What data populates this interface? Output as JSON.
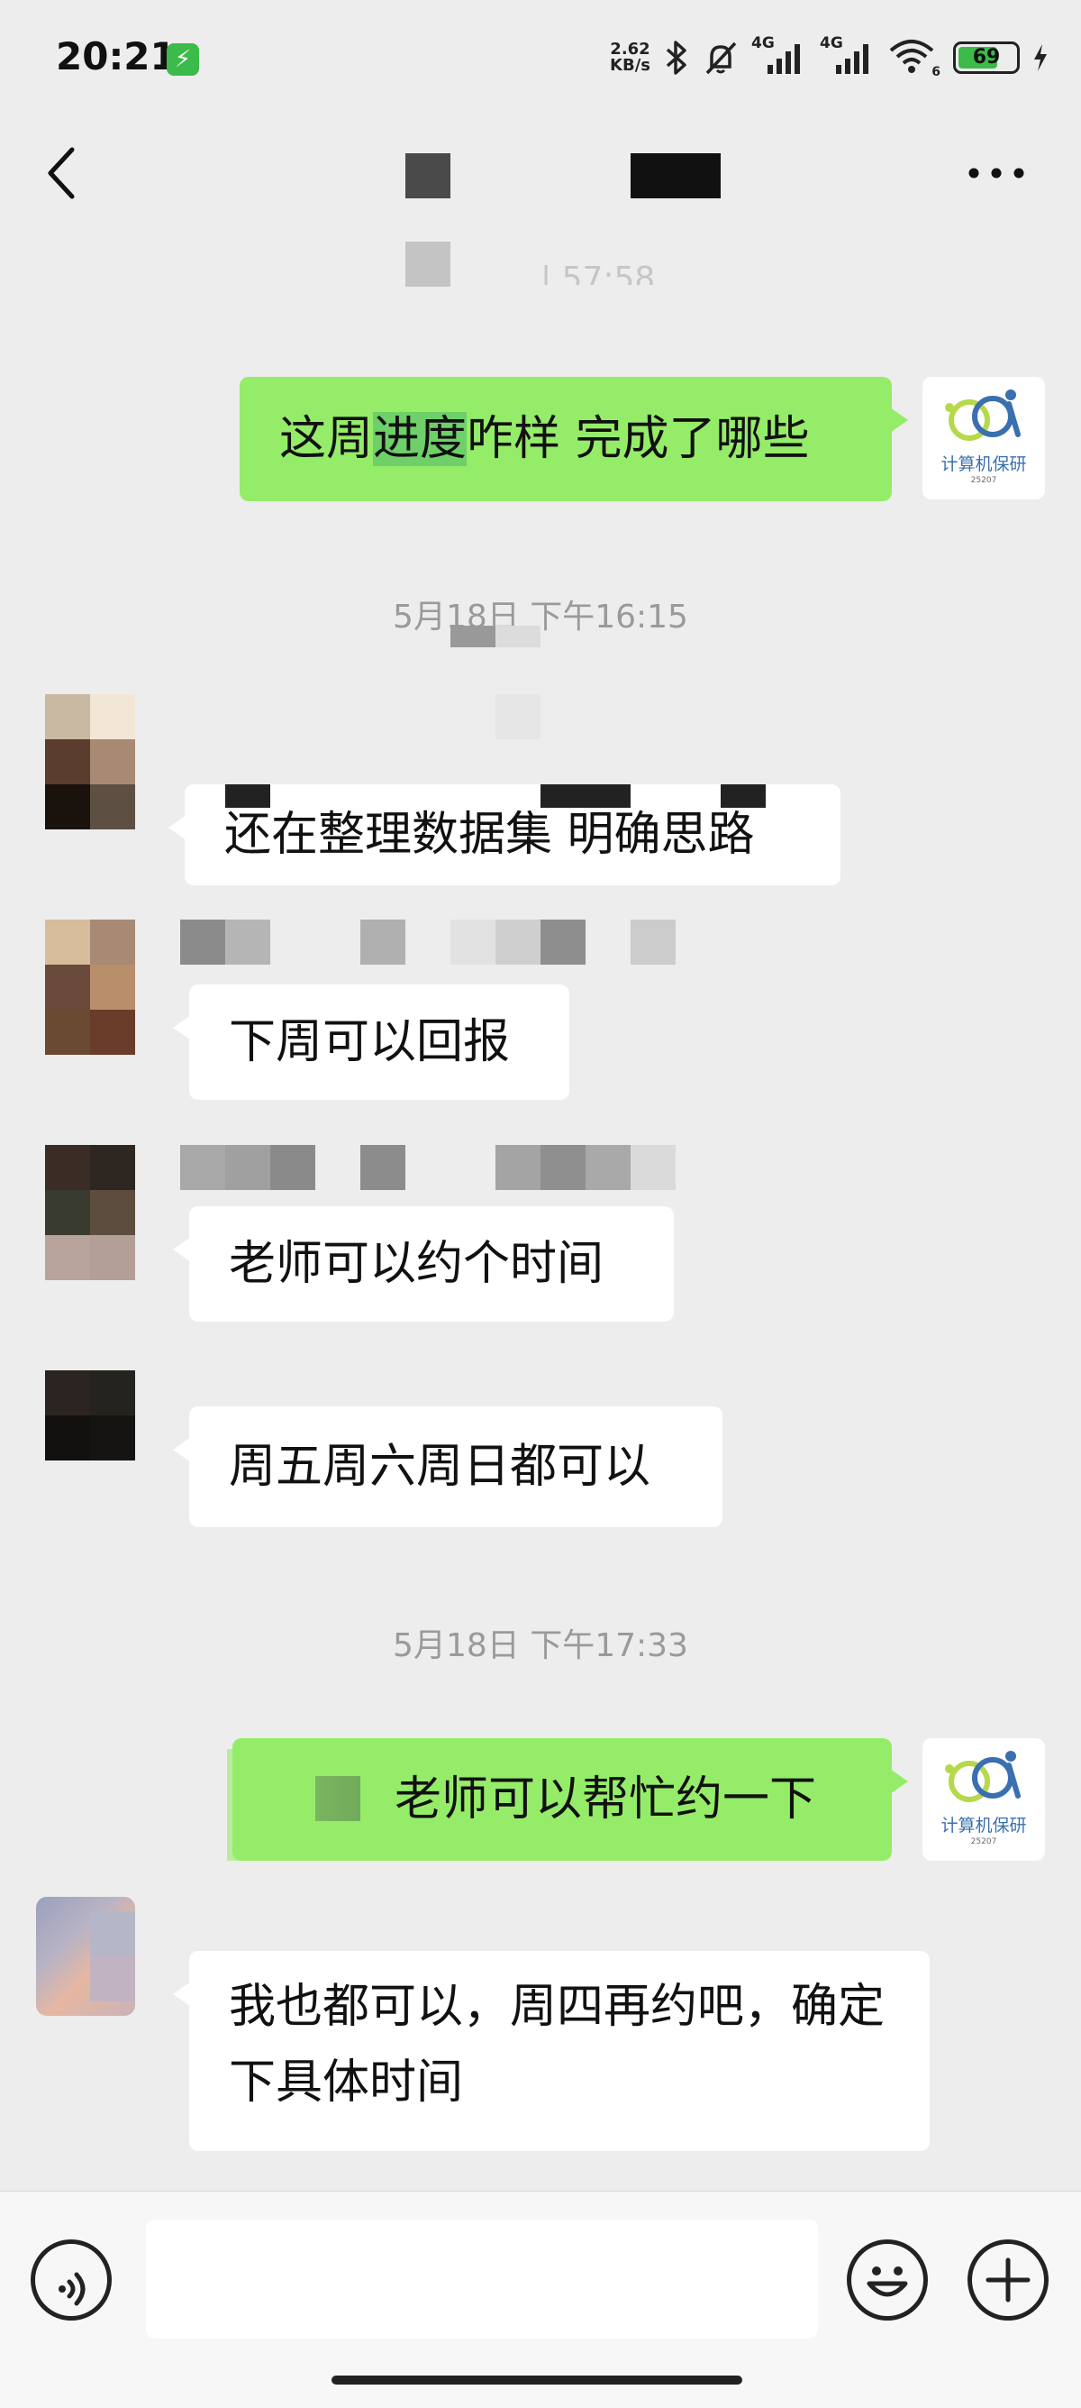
{
  "status_bar": {
    "time": "20:21",
    "net_speed_value": "2.62",
    "net_speed_unit": "KB/s",
    "network_1": "4G",
    "network_2": "4G",
    "wifi_label": "6",
    "battery_level": "69",
    "battery_fraction": 0.69
  },
  "colors": {
    "background": "#ededed",
    "sent_bubble": "#95ec69",
    "received_bubble": "#ffffff",
    "timestamp": "#9a9a9a",
    "logo_blue": "#3a6fb0",
    "logo_green": "#b6d94b"
  },
  "nav": {
    "back_icon": "chevron-left-icon",
    "more_icon": "ellipsis-icon",
    "partial_timestamp": "| 57:58"
  },
  "self_avatar": {
    "label": "计算机保研",
    "sub": "25207"
  },
  "chat": {
    "timestamp_1": "5月18日 下午16:15",
    "timestamp_2": "5月18日 下午17:33",
    "msg_sent_1_part1": "这周",
    "msg_sent_1_highlight": "进度",
    "msg_sent_1_part2": "咋样 完成了哪些",
    "msg_recv_1": "还在整理数据集 明确思路",
    "msg_recv_2": "下周可以回报",
    "msg_recv_3": "老师可以约个时间",
    "msg_recv_4": "周五周六周日都可以",
    "msg_sent_2": "老师可以帮忙约一下",
    "msg_recv_5": "我也都可以，周四再约吧，确定下具体时间"
  },
  "input_bar": {
    "voice_icon": "voice-icon",
    "emoji_icon": "emoji-icon",
    "plus_icon": "plus-icon",
    "input_value": ""
  }
}
